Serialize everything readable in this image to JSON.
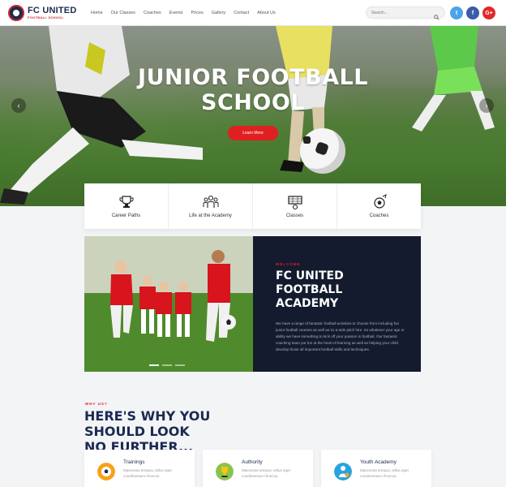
{
  "header": {
    "logo_title": "FC UNITED",
    "logo_sub": "FOOTBALL SCHOOL",
    "nav": [
      "Home",
      "Our Classes",
      "Coaches",
      "Events",
      "Prices",
      "Gallery",
      "Contact",
      "About Us"
    ],
    "search_placeholder": "Search...",
    "social": {
      "twitter": "t",
      "facebook": "f",
      "google": "G+"
    }
  },
  "hero": {
    "title_line1": "JUNIOR FOOTBALL",
    "title_line2": "SCHOOL",
    "button": "Learn More",
    "prev": "‹",
    "next": "›"
  },
  "features": [
    {
      "label": "Career Paths",
      "icon": "trophy-icon"
    },
    {
      "label": "Life at the Academy",
      "icon": "team-icon"
    },
    {
      "label": "Classes",
      "icon": "goal-icon"
    },
    {
      "label": "Coaches",
      "icon": "ball-icon"
    }
  ],
  "academy": {
    "eyebrow": "WELCOME",
    "title_line1": "FC UNITED",
    "title_line2": "FOOTBALL ACADEMY",
    "description": "We have a range of fantastic football activities to choose from including fun junior football courses as well as 11-a-side pitch hire. So whatever your age or ability we have something to kick off your passion in football. Our fantastic coaching team put fun at the heart of learning as well as helping your child develop those all important football skills and techniques."
  },
  "why": {
    "eyebrow": "WHY US?",
    "title_line1": "HERE'S WHY YOU SHOULD LOOK",
    "title_line2": "NO FURTHER..."
  },
  "cards": [
    {
      "title": "Trainings",
      "description": "Maecenas tempus, tellus eget condimentum rhoncus.",
      "icon": "football-icon",
      "color": "#f5a31a"
    },
    {
      "title": "Authority",
      "description": "Maecenas tempus, tellus eget condimentum rhoncus.",
      "icon": "trophy-icon",
      "color": "#8bc34a"
    },
    {
      "title": "Youth Academy",
      "description": "Maecenas tempus, tellus eget condimentum rhoncus.",
      "icon": "youth-icon",
      "color": "#29a3e0"
    }
  ],
  "colors": {
    "navy": "#1c2a52",
    "red": "#e02020",
    "dark_panel": "#141b2e"
  }
}
